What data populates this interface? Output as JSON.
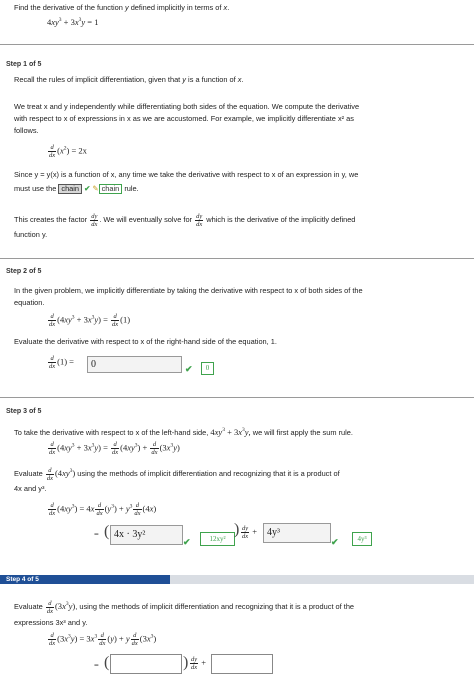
{
  "problem": {
    "prompt_prefix": "Find the derivative of the function ",
    "prompt_var": "y",
    "prompt_suffix": " defined implicitly in terms of ",
    "prompt_x": "x",
    "equation_rhs": " = 1"
  },
  "step1": {
    "label": "Step 1 of 5",
    "recall_pre": "Recall the rules of implicit differentiation, given that ",
    "recall_y": "y",
    "recall_mid": " is a function of ",
    "recall_x": "x",
    "para1_l1": "We treat x and y independently while differentiating both sides of the equation. We compute the derivative",
    "para1_l2": "with respect to x of expressions in x as we are accustomed. For example, we implicitly differentiate x² as",
    "para1_l3": "follows.",
    "example_rhs": " = 2x",
    "since_l1": "Since  y = y(x)  is a function of x, any time we take the derivative with respect to x of an expression in y, we",
    "since_l2_pre": "must use the",
    "since_chip": "chain",
    "since_answer": "chain",
    "since_l2_post": "rule.",
    "factor_pre": "This creates the factor",
    "factor_mid": ". We will eventually solve for",
    "factor_post": "which is the derivative of the implicitly defined",
    "factor_l2": "function y."
  },
  "step2": {
    "label": "Step 2 of 5",
    "para_l1": "In the given problem, we implicitly differentiate by taking the derivative with respect to x of both sides of the",
    "para_l2": "equation.",
    "eval_text": "Evaluate the derivative with respect to x of the right-hand side of the equation, 1.",
    "input_value": "0",
    "answer_value": "0"
  },
  "step3": {
    "label": "Step 3 of 5",
    "intro": "To take the derivative with respect to x of the left-hand side,",
    "intro_post": "we will first apply the sum rule.",
    "eval_pre": "Evaluate",
    "eval_post": "using the methods of implicit differentiation and recognizing that it is a product of",
    "eval_l2": "4x and y³.",
    "input1": "4x · 3y²",
    "answer1": "12xy²",
    "input2": "4y³",
    "answer2": "4y³"
  },
  "step4": {
    "label": "Step 4 of 5",
    "eval_pre": "Evaluate",
    "eval_post": "using the methods of implicit differentiation and recognizing that it is a product of the",
    "eval_l2": "expressions 3x³ and y."
  },
  "colors": {
    "correct": "#3fa34d",
    "step_bar": "#1f4f96"
  },
  "icons": {
    "check": "check-icon",
    "pencil": "pencil-icon"
  }
}
